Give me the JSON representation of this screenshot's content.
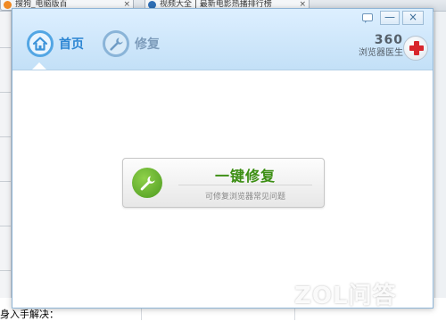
{
  "background": {
    "tabs": [
      {
        "label": "搜狗_电脑版百",
        "favicon_color": "#f08a24"
      },
      {
        "label": "视频大全 | 最新电影热播排行榜",
        "favicon_color": "#2f6fb5"
      }
    ],
    "tab_close": "×",
    "bottom_text": "身入手解决："
  },
  "dialog": {
    "title_controls": {
      "feedback_icon": "feedback-icon",
      "minimize": "—",
      "close": "×"
    },
    "nav": [
      {
        "label": "首页",
        "icon": "home-icon",
        "active": true
      },
      {
        "label": "修复",
        "icon": "wrench-icon",
        "active": false
      }
    ],
    "brand": {
      "number": "360",
      "name": "浏览器医生",
      "icon": "medical-cross-icon"
    },
    "repair_button": {
      "title": "一键修复",
      "subtitle": "可修复浏览器常见问题",
      "icon": "wrench-icon"
    }
  },
  "watermark": {
    "text": "ZOL问答"
  },
  "colors": {
    "header_top": "#ddefff",
    "header_bottom": "#c3e0f7",
    "nav_active": "#2d86d3",
    "nav_inactive": "#7d9cbb",
    "repair_green": "#3b8e12",
    "cross_red": "#d8262d"
  }
}
